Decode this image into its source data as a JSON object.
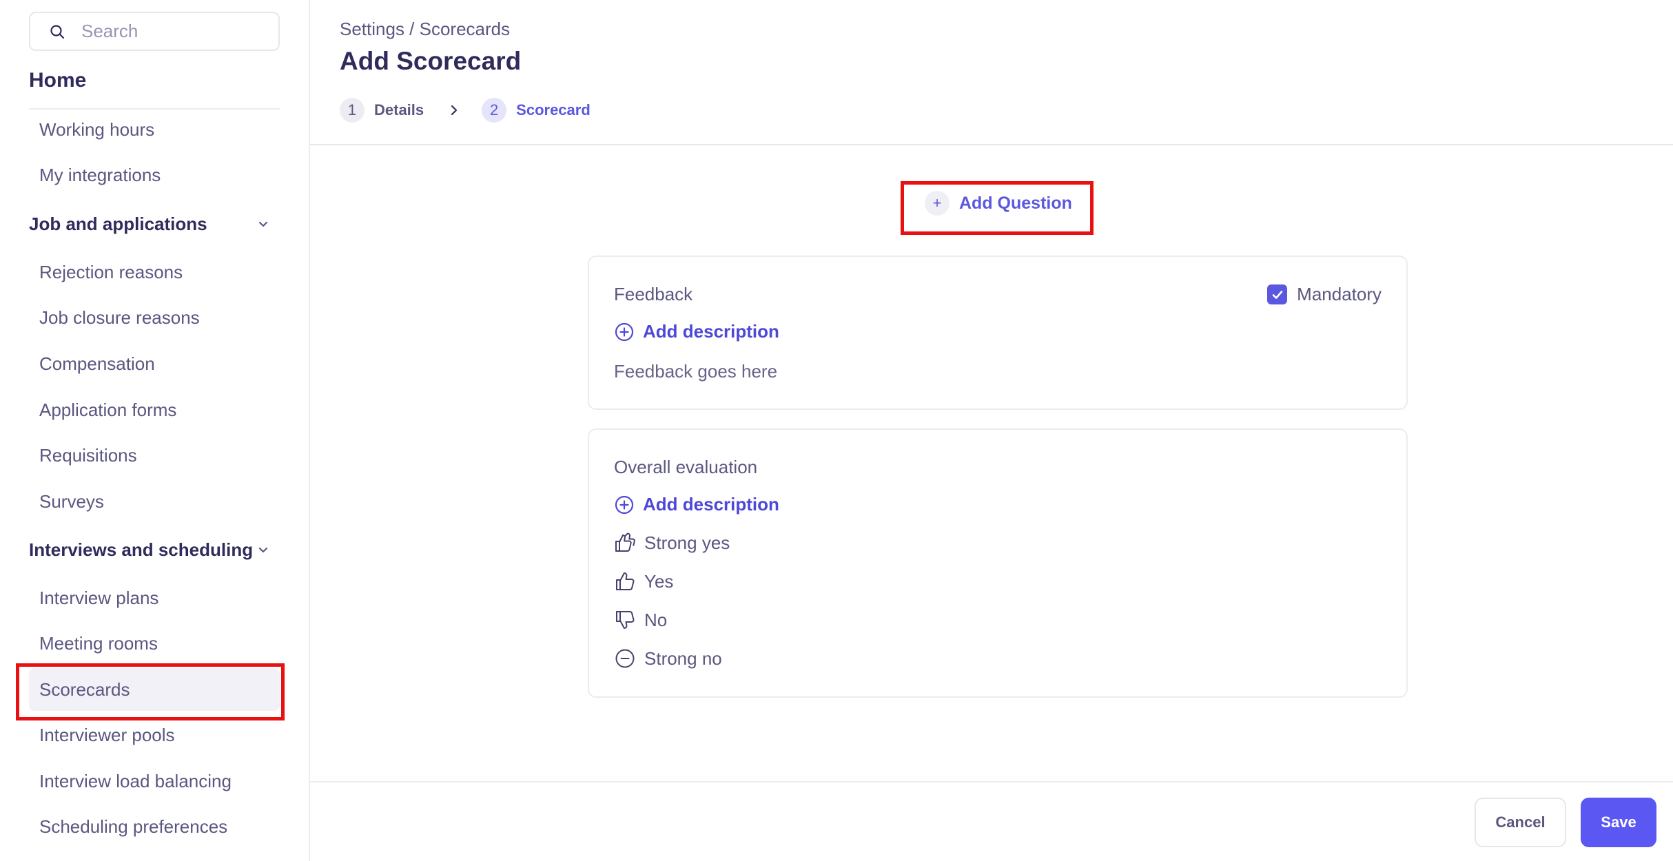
{
  "search": {
    "placeholder": "Search",
    "icon": "search-icon"
  },
  "sidebar": {
    "home": "Home",
    "items": [
      {
        "label": "Working hours"
      },
      {
        "label": "My integrations"
      }
    ],
    "sections": [
      {
        "title": "Job and applications",
        "items": [
          {
            "label": "Rejection reasons"
          },
          {
            "label": "Job closure reasons"
          },
          {
            "label": "Compensation"
          },
          {
            "label": "Application forms"
          },
          {
            "label": "Requisitions"
          },
          {
            "label": "Surveys"
          }
        ]
      },
      {
        "title": "Interviews and scheduling",
        "items": [
          {
            "label": "Interview plans"
          },
          {
            "label": "Meeting rooms"
          },
          {
            "label": "Scorecards",
            "active": true
          },
          {
            "label": "Interviewer pools"
          },
          {
            "label": "Interview load balancing"
          },
          {
            "label": "Scheduling preferences"
          }
        ]
      }
    ]
  },
  "header": {
    "breadcrumb": "Settings / Scorecards",
    "title": "Add Scorecard",
    "steps": [
      {
        "number": "1",
        "label": "Details"
      },
      {
        "number": "2",
        "label": "Scorecard",
        "current": true
      }
    ]
  },
  "main": {
    "add_question": {
      "plus": "+",
      "label": "Add Question"
    },
    "feedback_card": {
      "title": "Feedback",
      "mandatory_label": "Mandatory",
      "mandatory_checked": true,
      "add_description": "Add description",
      "placeholder_text": "Feedback goes here"
    },
    "evaluation_card": {
      "title": "Overall evaluation",
      "add_description": "Add description",
      "options": [
        {
          "label": "Strong yes",
          "icon": "double-thumbs-up-icon"
        },
        {
          "label": "Yes",
          "icon": "thumbs-up-icon"
        },
        {
          "label": "No",
          "icon": "thumbs-down-icon"
        },
        {
          "label": "Strong no",
          "icon": "minus-circle-icon"
        }
      ]
    }
  },
  "footer": {
    "cancel": "Cancel",
    "save": "Save"
  },
  "colors": {
    "accent": "#5b57f2",
    "highlight": "#e81010",
    "text": "#45416b"
  }
}
